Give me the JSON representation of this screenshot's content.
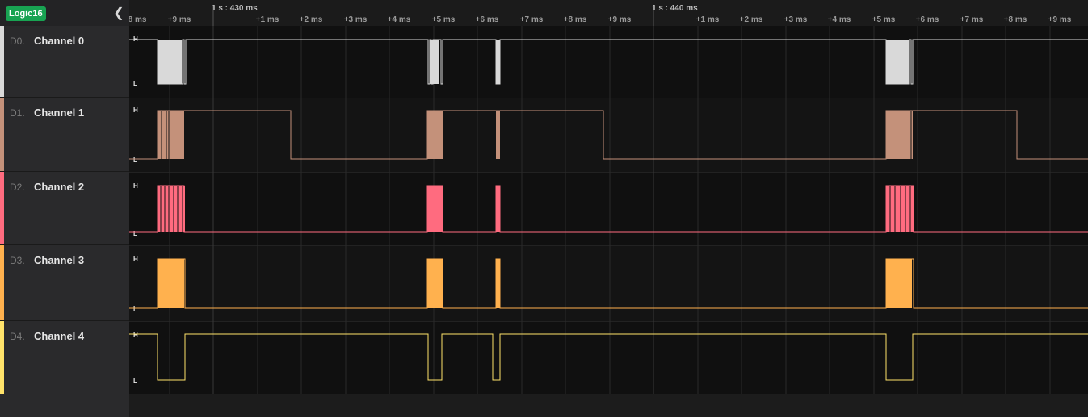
{
  "device": {
    "badge": "Logic16",
    "collapse_icon": "chevron-left-icon"
  },
  "timeline": {
    "markers": [
      {
        "label": "1 s : 430 ms"
      },
      {
        "label": "1 s : 440 ms"
      }
    ],
    "ticks": [
      "8 ms",
      "+9 ms",
      "+1 ms",
      "+2 ms",
      "+3 ms",
      "+4 ms",
      "+5 ms",
      "+6 ms",
      "+7 ms",
      "+8 ms",
      "+9 ms",
      "+1 ms",
      "+2 ms",
      "+3 ms",
      "+4 ms",
      "+5 ms",
      "+6 ms",
      "+7 ms",
      "+8 ms",
      "+9 ms"
    ]
  },
  "level_labels": {
    "high": "H",
    "low": "L"
  },
  "channels": [
    {
      "id": "D0.",
      "name": "Channel 0",
      "color": "#d9d9d9"
    },
    {
      "id": "D1.",
      "name": "Channel 1",
      "color": "#c4917a"
    },
    {
      "id": "D2.",
      "name": "Channel 2",
      "color": "#ff6b7f"
    },
    {
      "id": "D3.",
      "name": "Channel 3",
      "color": "#ffb14e"
    },
    {
      "id": "D4.",
      "name": "Channel 4",
      "color": "#ffe36a"
    }
  ],
  "colors": {
    "background": "#0f0f0f",
    "sidebar": "#2a2a2c",
    "accent": "#18a352"
  }
}
